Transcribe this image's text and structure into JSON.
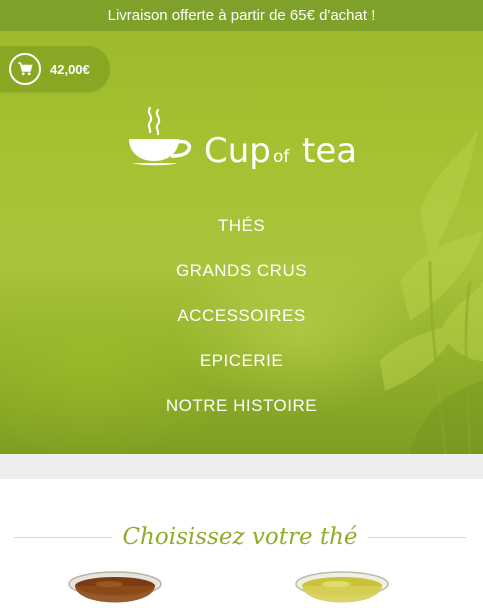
{
  "topbar": {
    "message": "Livraison offerte à partir de 65€ d'achat !"
  },
  "cart": {
    "total": "42,00€",
    "icon": "cart-icon"
  },
  "logo": {
    "word1": "Cup",
    "word2": "of",
    "word3": "tea",
    "icon": "steaming-teacup-icon"
  },
  "nav": {
    "items": [
      {
        "label": "THÉS"
      },
      {
        "label": "GRANDS CRUS"
      },
      {
        "label": "ACCESSOIRES"
      },
      {
        "label": "EPICERIE"
      },
      {
        "label": "NOTRE HISTOIRE"
      }
    ]
  },
  "section": {
    "title": "Choisissez votre thé"
  },
  "colors": {
    "brand_green": "#7ea12a",
    "title_green": "#8fac2a"
  }
}
